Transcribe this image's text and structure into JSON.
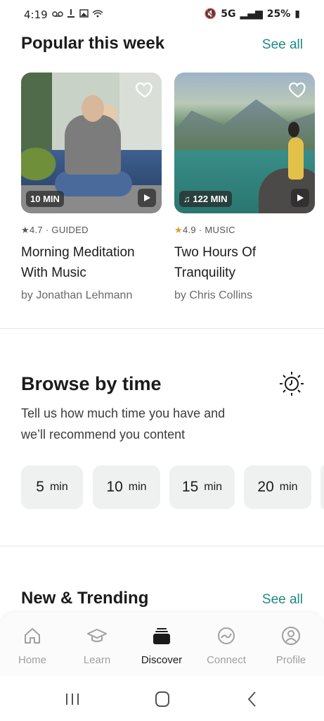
{
  "status_bar": {
    "time": "4:19",
    "left_icons": "voicemail-icon download-icon image-icon wifi-icon",
    "network": "5G",
    "battery": "25%"
  },
  "popular": {
    "title": "Popular this week",
    "see_all": "See all",
    "cards": [
      {
        "duration": "10 MIN",
        "rating": "4.7",
        "category": "GUIDED",
        "title_line1": "Morning Meditation",
        "title_line2": "With Music",
        "author": "by Jonathan Lehmann"
      },
      {
        "duration": "122 MIN",
        "rating": "4.9",
        "category": "MUSIC",
        "title_line1": "Two Hours Of",
        "title_line2": "Tranquility",
        "author": "by Chris Collins"
      }
    ]
  },
  "browse": {
    "title": "Browse by time",
    "description_line1": "Tell us how much time you have and",
    "description_line2": "we’ll recommend you content",
    "options": [
      {
        "num": "5",
        "unit": "min"
      },
      {
        "num": "10",
        "unit": "min"
      },
      {
        "num": "15",
        "unit": "min"
      },
      {
        "num": "20",
        "unit": "min"
      }
    ]
  },
  "trending": {
    "title": "New & Trending",
    "see_all": "See all"
  },
  "nav": {
    "items": [
      {
        "label": "Home",
        "icon": "home-icon"
      },
      {
        "label": "Learn",
        "icon": "graduation-cap-icon"
      },
      {
        "label": "Discover",
        "icon": "discover-stack-icon"
      },
      {
        "label": "Connect",
        "icon": "connect-globe-icon"
      },
      {
        "label": "Profile",
        "icon": "profile-icon"
      }
    ],
    "active": "Discover"
  },
  "colors": {
    "accent": "#1e8a84",
    "star_gold": "#d6a233",
    "pill_bg": "#eef1f0"
  }
}
